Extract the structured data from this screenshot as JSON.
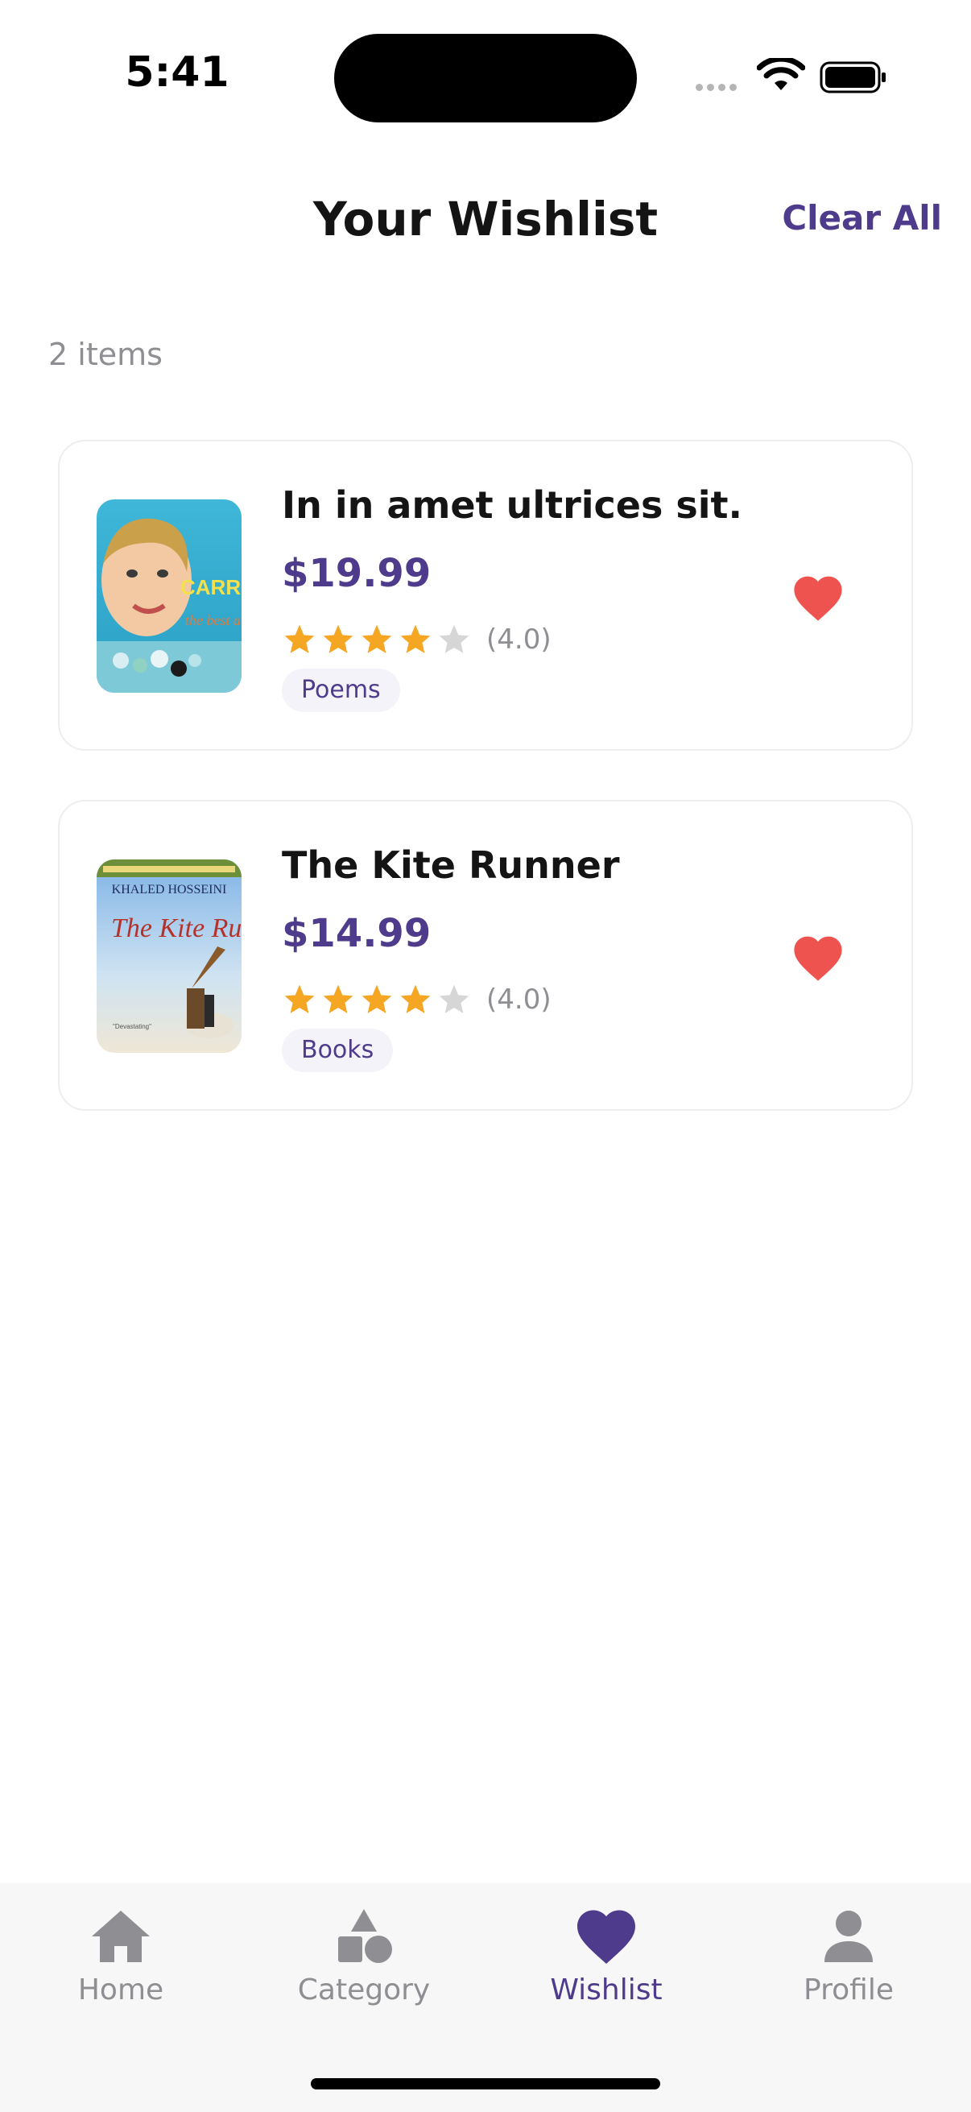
{
  "status_bar": {
    "time": "5:41"
  },
  "header": {
    "title": "Your Wishlist",
    "clear_all_label": "Clear All"
  },
  "items_count": "2 items",
  "wishlist": [
    {
      "title": "In in amet ultrices sit.",
      "price": "$19.99",
      "rating": 4,
      "rating_text": "(4.0)",
      "category": "Poems",
      "cover_text": {
        "author": "CARRIE FISHER",
        "subtitle": "the best awful"
      }
    },
    {
      "title": "The Kite Runner",
      "price": "$14.99",
      "rating": 4,
      "rating_text": "(4.0)",
      "category": "Books",
      "cover_text": {
        "author": "KHALED HOSSEINI",
        "title": "The Kite Runner"
      }
    }
  ],
  "tab_bar": {
    "home": "Home",
    "category": "Category",
    "wishlist": "Wishlist",
    "profile": "Profile",
    "active": "wishlist"
  },
  "colors": {
    "accent": "#4f3b8c",
    "heart": "#ef5350",
    "star_filled": "#f5a623",
    "star_empty": "#d6d6d6",
    "muted_text": "#8e8e93"
  }
}
